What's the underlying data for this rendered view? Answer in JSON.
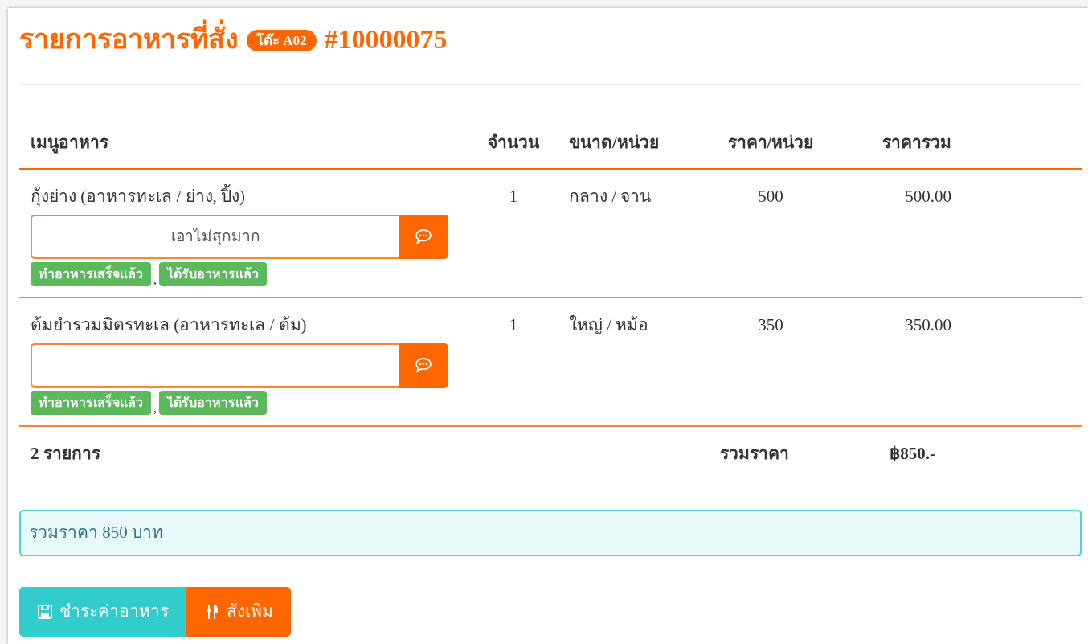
{
  "title": {
    "text": "รายการอาหารที่สั่ง",
    "table_badge": "โต๊ะ A02",
    "order_number": "#10000075"
  },
  "table": {
    "columns": [
      "เมนูอาหาร",
      "จำนวน",
      "ขนาด/หน่วย",
      "ราคา/หน่วย",
      "ราคารวม"
    ],
    "rows": [
      {
        "menu": "กุ้งย่าง (อาหารทะเล / ย่าง, ปิ้ง)",
        "note": "เอาไม่สุกมาก",
        "statuses": [
          "ทำอาหารเสร็จแล้ว",
          "ได้รับอาหารแล้ว"
        ],
        "quantity": "1",
        "size_unit": "กลาง / จาน",
        "unit_price": "500",
        "total": "500.00"
      },
      {
        "menu": "ต้มยำรวมมิตรทะเล (อาหารทะเล / ต้ม)",
        "note": "",
        "statuses": [
          "ทำอาหารเสร็จแล้ว",
          "ได้รับอาหารแล้ว"
        ],
        "quantity": "1",
        "size_unit": "ใหญ่ / หม้อ",
        "unit_price": "350",
        "total": "350.00"
      }
    ],
    "footer": {
      "count": "2 รายการ",
      "total_label": "รวมราคา",
      "grand_total": "฿850.-"
    }
  },
  "status_separator": ",",
  "summary": "รวมราคา 850 บาท",
  "buttons": [
    {
      "kind": "pay",
      "label": "ชำระค่าอาหาร"
    },
    {
      "kind": "order_more",
      "label": "สั่งเพิ่ม"
    }
  ]
}
